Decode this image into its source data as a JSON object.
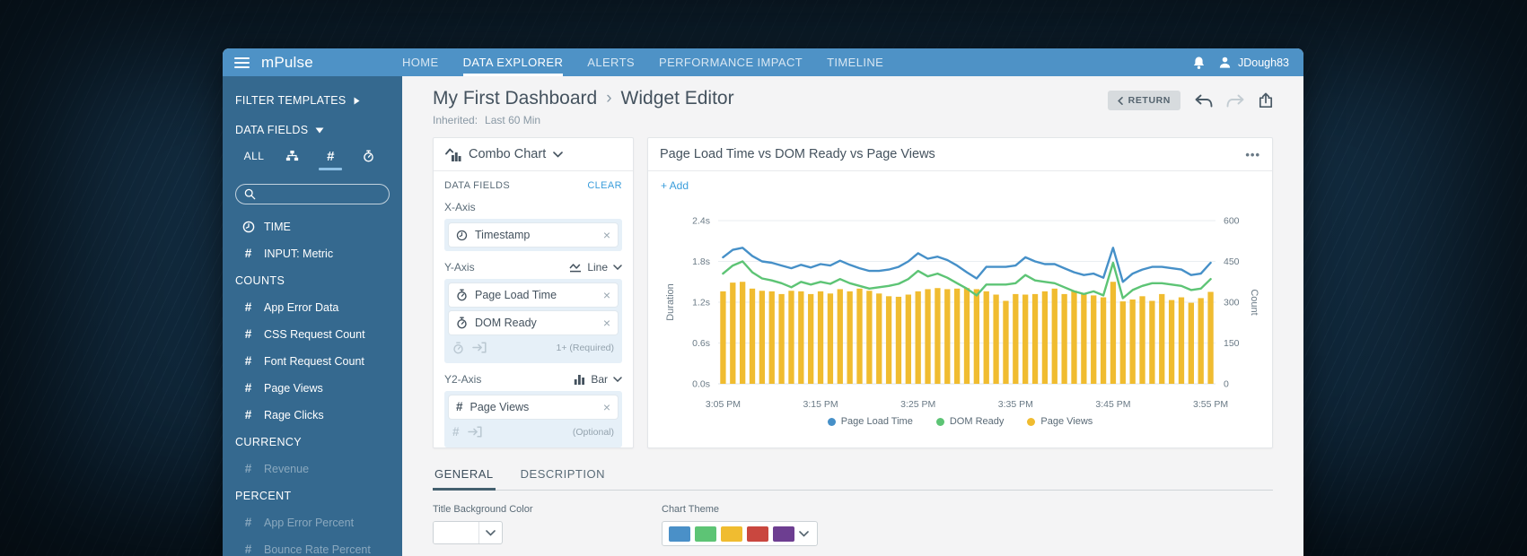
{
  "icons": {
    "close": "×",
    "more": "•••",
    "breadcrumb_sep": "›"
  },
  "navbar": {
    "brand": "mPulse",
    "items": [
      {
        "label": "HOME",
        "active": false
      },
      {
        "label": "DATA EXPLORER",
        "active": true
      },
      {
        "label": "ALERTS",
        "active": false
      },
      {
        "label": "PERFORMANCE IMPACT",
        "active": false
      },
      {
        "label": "TIMELINE",
        "active": false
      }
    ],
    "user": "JDough83"
  },
  "sidebar": {
    "filter_templates": "FILTER TEMPLATES",
    "data_fields": "DATA FIELDS",
    "tabs": {
      "all": "ALL"
    },
    "search": {
      "placeholder": ""
    },
    "rows": [
      {
        "type": "item",
        "icon": "clock-icon",
        "label": "TIME"
      },
      {
        "type": "item",
        "icon": "hash-icon",
        "label": "INPUT: Metric"
      },
      {
        "type": "header",
        "label": "COUNTS"
      },
      {
        "type": "item",
        "icon": "hash-icon",
        "label": "App Error Data"
      },
      {
        "type": "item",
        "icon": "hash-icon",
        "label": "CSS Request Count"
      },
      {
        "type": "item",
        "icon": "hash-icon",
        "label": "Font Request Count"
      },
      {
        "type": "item",
        "icon": "hash-icon",
        "label": "Page Views"
      },
      {
        "type": "item",
        "icon": "hash-icon",
        "label": "Rage Clicks"
      },
      {
        "type": "header",
        "label": "CURRENCY"
      },
      {
        "type": "item",
        "icon": "hash-icon",
        "label": "Revenue",
        "disabled": true
      },
      {
        "type": "header",
        "label": "PERCENT"
      },
      {
        "type": "item",
        "icon": "hash-icon",
        "label": "App Error Percent",
        "disabled": true
      },
      {
        "type": "item",
        "icon": "hash-icon",
        "label": "Bounce Rate Percent",
        "disabled": true
      }
    ]
  },
  "header": {
    "breadcrumb": [
      "My First Dashboard",
      "Widget Editor"
    ],
    "meta_label": "Inherited:",
    "meta_value": "Last 60 Min",
    "return_label": "RETURN"
  },
  "editor": {
    "chart_type": "Combo Chart",
    "data_fields_label": "DATA FIELDS",
    "clear_label": "CLEAR",
    "x_axis": {
      "label": "X-Axis",
      "chips": [
        {
          "icon": "clock-icon",
          "label": "Timestamp"
        }
      ]
    },
    "y_axis": {
      "label": "Y-Axis",
      "type_label": "Line",
      "chips": [
        {
          "icon": "timer-icon",
          "label": "Page Load Time"
        },
        {
          "icon": "timer-icon",
          "label": "DOM Ready"
        }
      ],
      "placeholder": "1+ (Required)"
    },
    "y2_axis": {
      "label": "Y2-Axis",
      "type_label": "Bar",
      "chips": [
        {
          "icon": "hash-icon",
          "label": "Page Views"
        }
      ],
      "placeholder": "(Optional)"
    }
  },
  "widget": {
    "title": "Page Load Time vs DOM Ready vs Page Views",
    "add_label": "+ Add"
  },
  "footer_tabs": {
    "general": "GENERAL",
    "description": "DESCRIPTION"
  },
  "settings": {
    "title_bg_label": "Title Background Color",
    "title_bg_value": "#ffffff",
    "chart_theme_label": "Chart Theme",
    "theme_colors": [
      "#4a90c8",
      "#5dc475",
      "#f0bc30",
      "#c9473f",
      "#6d3e91"
    ]
  },
  "chart_data": {
    "type": "combo",
    "x_tick_labels": [
      "3:05 PM",
      "3:15 PM",
      "3:25 PM",
      "3:35 PM",
      "3:45 PM",
      "3:55 PM"
    ],
    "left_axis": {
      "label": "Duration",
      "ticks": [
        "0.0s",
        "0.6s",
        "1.2s",
        "1.8s",
        "2.4s"
      ],
      "min": 0,
      "max": 2.4
    },
    "right_axis": {
      "label": "Count",
      "ticks": [
        "0",
        "150",
        "300",
        "450",
        "600"
      ],
      "min": 0,
      "max": 600
    },
    "legend_position": "bottom",
    "series": [
      {
        "name": "Page Load Time",
        "type": "line",
        "axis": "left",
        "color": "#4690c8",
        "values": [
          1.86,
          1.97,
          2.0,
          1.88,
          1.8,
          1.78,
          1.74,
          1.7,
          1.75,
          1.71,
          1.76,
          1.74,
          1.81,
          1.75,
          1.7,
          1.66,
          1.66,
          1.68,
          1.72,
          1.8,
          1.92,
          1.84,
          1.87,
          1.82,
          1.74,
          1.64,
          1.55,
          1.72,
          1.72,
          1.72,
          1.74,
          1.86,
          1.8,
          1.76,
          1.76,
          1.7,
          1.64,
          1.6,
          1.62,
          1.56,
          2.0,
          1.5,
          1.62,
          1.68,
          1.72,
          1.72,
          1.7,
          1.68,
          1.6,
          1.62,
          1.78
        ]
      },
      {
        "name": "DOM Ready",
        "type": "line",
        "axis": "left",
        "color": "#5dc475",
        "values": [
          1.62,
          1.74,
          1.8,
          1.64,
          1.55,
          1.52,
          1.48,
          1.42,
          1.5,
          1.46,
          1.5,
          1.47,
          1.54,
          1.48,
          1.44,
          1.4,
          1.42,
          1.44,
          1.47,
          1.54,
          1.66,
          1.58,
          1.62,
          1.56,
          1.48,
          1.4,
          1.3,
          1.46,
          1.46,
          1.46,
          1.48,
          1.6,
          1.52,
          1.5,
          1.48,
          1.42,
          1.36,
          1.32,
          1.36,
          1.3,
          1.78,
          1.26,
          1.38,
          1.44,
          1.48,
          1.48,
          1.46,
          1.44,
          1.38,
          1.4,
          1.54
        ]
      },
      {
        "name": "Page Views",
        "type": "bar",
        "axis": "right",
        "color": "#f0bc30",
        "values": [
          340,
          372,
          375,
          350,
          342,
          340,
          330,
          342,
          340,
          330,
          340,
          332,
          348,
          340,
          350,
          342,
          332,
          322,
          320,
          328,
          340,
          348,
          352,
          348,
          350,
          352,
          348,
          340,
          328,
          305,
          330,
          328,
          330,
          340,
          350,
          330,
          342,
          332,
          325,
          318,
          375,
          303,
          310,
          322,
          305,
          330,
          308,
          318,
          298,
          315,
          338
        ]
      }
    ]
  }
}
